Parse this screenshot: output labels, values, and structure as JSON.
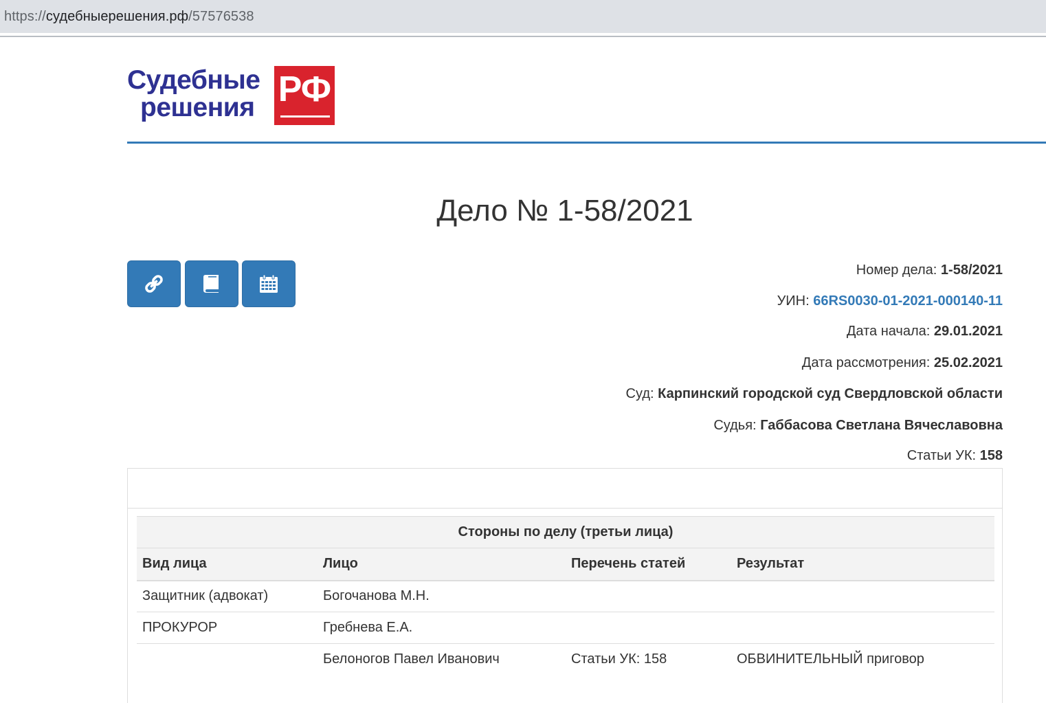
{
  "browser": {
    "url_scheme": "https://",
    "url_host": "судебныерешения.рф",
    "url_path": "/57576538"
  },
  "logo": {
    "line1": "Судебные",
    "line2": "решения",
    "badge": "РФ"
  },
  "case": {
    "title": "Дело № 1-58/2021"
  },
  "toolbar": {
    "buttons": [
      {
        "icon": "link-icon"
      },
      {
        "icon": "book-icon"
      },
      {
        "icon": "calendar-icon"
      }
    ]
  },
  "details": {
    "number_label": "Номер дела:",
    "number_value": "1-58/2021",
    "uin_label": "УИН:",
    "uin_value": "66RS0030-01-2021-000140-11",
    "start_label": "Дата начала:",
    "start_value": "29.01.2021",
    "review_label": "Дата рассмотрения:",
    "review_value": "25.02.2021",
    "court_label": "Суд:",
    "court_value": "Карпинский городской суд Свердловской области",
    "judge_label": "Судья:",
    "judge_value": "Габбасова Светлана Вячеславовна",
    "articles_label": "Статьи УК:",
    "articles_value": "158"
  },
  "parties": {
    "caption": "Стороны по делу (третьи лица)",
    "columns": [
      "Вид лица",
      "Лицо",
      "Перечень статей",
      "Результат"
    ],
    "rows": [
      [
        "Защитник (адвокат)",
        "Богочанова М.Н.",
        "",
        ""
      ],
      [
        "ПРОКУРОР",
        "Гребнева Е.А.",
        "",
        ""
      ],
      [
        "",
        "Белоногов Павел Иванович",
        "Статьи УК: 158",
        "ОБВИНИТЕЛЬНЫЙ приговор"
      ]
    ]
  },
  "colors": {
    "brand_blue": "#337ab7",
    "logo_blue": "#2e3192",
    "logo_red": "#d9232d",
    "table_header_bg": "#f3f3f3"
  }
}
